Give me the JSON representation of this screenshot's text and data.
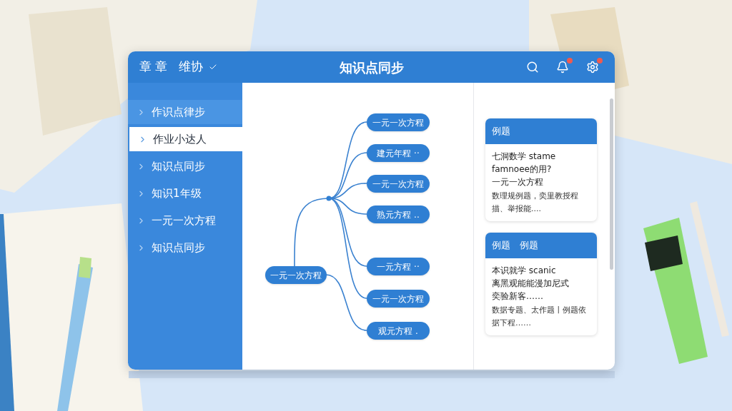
{
  "header": {
    "left_labels": [
      "章 章",
      "维协"
    ],
    "title": "知识点同步",
    "icons": [
      {
        "kind": "search",
        "badge": false
      },
      {
        "kind": "bell",
        "badge": true
      },
      {
        "kind": "gear",
        "badge": true
      }
    ]
  },
  "sidebar": {
    "items": [
      {
        "label": "作识点律步",
        "selected": false,
        "hovered": true
      },
      {
        "label": "作业小达人",
        "selected": true,
        "hovered": false
      },
      {
        "label": "知识点同步",
        "selected": false,
        "hovered": false
      },
      {
        "label": "知识1年级",
        "selected": false,
        "hovered": false
      },
      {
        "label": "一元一次方程",
        "selected": false,
        "hovered": false
      },
      {
        "label": "知识点同步",
        "selected": false,
        "hovered": false
      }
    ]
  },
  "mind_map": {
    "root": "一元一次方程",
    "children": [
      "一元一次方程",
      "建元年程 ··",
      "一元一次方程",
      "熟元方程 ..",
      "一元方程 ··",
      "一元一次方程",
      "观元方程 ."
    ]
  },
  "cards": [
    {
      "title": "例题",
      "lines": [
        "七洞数学 stame",
        "famnoee的用?",
        "一元一次方程"
      ],
      "summary": "数理规例题，奕里教授程描、举报能...."
    },
    {
      "title": "例题　例题",
      "lines": [
        "本识就学 scanic",
        "离黑观能能漫加尼式",
        "奕验新客……"
      ],
      "summary": "数据专题、太作题丨例题依据下程……"
    }
  ]
}
